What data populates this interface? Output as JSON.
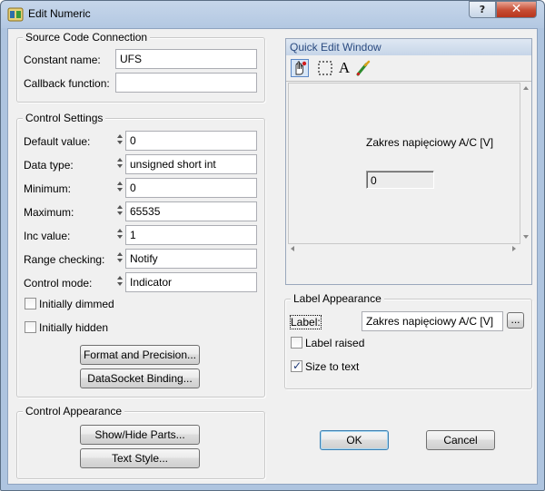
{
  "window": {
    "title": "Edit Numeric",
    "help_label": "?",
    "close_label": "✕"
  },
  "source_code": {
    "legend": "Source Code Connection",
    "constant_name_label": "Constant name:",
    "constant_name_value": "UFS",
    "callback_label": "Callback function:",
    "callback_value": ""
  },
  "control_settings": {
    "legend": "Control Settings",
    "fields": [
      {
        "label": "Default value:",
        "value": "0"
      },
      {
        "label": "Data type:",
        "value": "unsigned short int"
      },
      {
        "label": "Minimum:",
        "value": "0"
      },
      {
        "label": "Maximum:",
        "value": "65535"
      },
      {
        "label": "Inc value:",
        "value": "1"
      },
      {
        "label": "Range checking:",
        "value": "Notify"
      },
      {
        "label": "Control mode:",
        "value": "Indicator"
      }
    ],
    "initially_dimmed": "Initially dimmed",
    "initially_hidden": "Initially hidden",
    "format_button": "Format and Precision...",
    "datasocket_button": "DataSocket Binding..."
  },
  "control_appearance": {
    "legend": "Control Appearance",
    "show_hide_button": "Show/Hide Parts...",
    "text_style_button": "Text Style..."
  },
  "quick_edit": {
    "title": "Quick Edit Window",
    "tools": [
      "operate-tool-icon",
      "select-tool-icon",
      "text-tool-icon",
      "color-tool-icon"
    ],
    "text_tool_glyph": "A",
    "control_label": "Zakres napięciowy A/C [V]",
    "control_value": "0"
  },
  "label_appearance": {
    "legend": "Label Appearance",
    "label_label": "Label:",
    "label_value": "Zakres napięciowy A/C [V]",
    "browse_button": "...",
    "label_raised": "Label raised",
    "size_to_text": "Size to text",
    "size_to_text_checked": true,
    "check_glyph": "✓"
  },
  "buttons": {
    "ok": "OK",
    "cancel": "Cancel"
  },
  "colors": {
    "accent": "#5a87c5",
    "close": "#c64c33"
  }
}
